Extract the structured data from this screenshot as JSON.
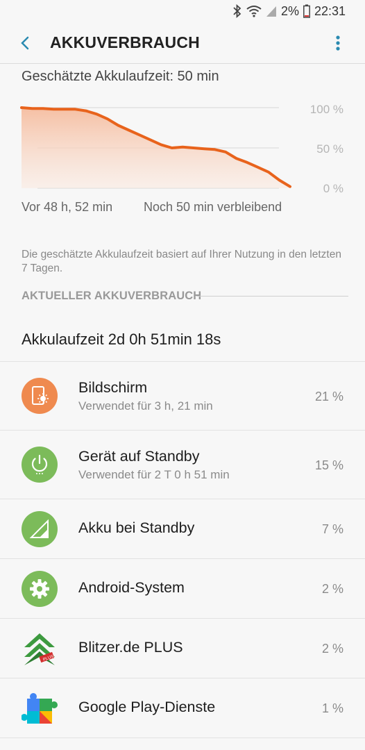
{
  "status_bar": {
    "battery_percent": "2%",
    "time": "22:31",
    "icons": [
      "bluetooth-icon",
      "wifi-icon",
      "cell-signal-icon",
      "battery-low-icon"
    ]
  },
  "app_bar": {
    "title": "AKKUVERBRAUCH",
    "back_icon": "back-arrow-icon",
    "menu_icon": "more-vert-icon"
  },
  "estimate_text": "Geschätzte Akkulaufzeit: 50 min",
  "chart_data": {
    "type": "area",
    "y_ticks": [
      "100 %",
      "50 %",
      "0 %"
    ],
    "ylim": [
      0,
      100
    ],
    "x_start_label": "Vor 48 h, 52 min",
    "x_end_label": "Noch 50 min verbleibend",
    "series": [
      {
        "values": [
          100,
          99,
          99,
          98,
          98,
          98,
          96,
          92,
          86,
          78,
          72,
          66,
          60,
          54,
          50,
          51,
          50,
          49,
          48,
          45,
          37,
          32,
          26,
          20,
          10,
          2
        ]
      }
    ],
    "line_color": "#e8631c",
    "fill_color": "#f5b99a",
    "grid": true
  },
  "note": "Die geschätzte Akkulaufzeit basiert auf Ihrer Nutzung in den letzten 7 Tagen.",
  "section_title": "AKTUELLER AKKUVERBRAUCH",
  "battery_life": "Akkulaufzeit 2d 0h 51min 18s",
  "usage_items": [
    {
      "name": "Bildschirm",
      "sub": "Verwendet für 3 h, 21 min",
      "percent": "21 %",
      "icon": "screen-brightness-icon",
      "color": "#ef8a4f"
    },
    {
      "name": "Gerät auf Standby",
      "sub": "Verwendet für 2 T 0 h 51 min",
      "percent": "15 %",
      "icon": "power-icon",
      "color": "#7cbb5a"
    },
    {
      "name": "Akku bei Standby",
      "sub": "",
      "percent": "7 %",
      "icon": "cell-signal-icon",
      "color": "#7cbb5a"
    },
    {
      "name": "Android-System",
      "sub": "",
      "percent": "2 %",
      "icon": "gear-icon",
      "color": "#7cbb5a"
    },
    {
      "name": "Blitzer.de PLUS",
      "sub": "",
      "percent": "2 %",
      "icon": "blitzer-app-icon",
      "color": "#3d9a3f"
    },
    {
      "name": "Google Play-Dienste",
      "sub": "",
      "percent": "1 %",
      "icon": "puzzle-piece-icon",
      "color": "#4285f4"
    }
  ]
}
